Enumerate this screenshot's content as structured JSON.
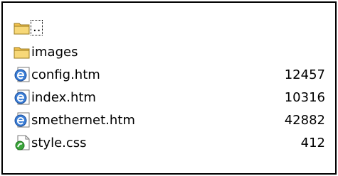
{
  "files": [
    {
      "name": "..",
      "icon": "folder-icon",
      "size": ""
    },
    {
      "name": "images",
      "icon": "folder-icon",
      "size": ""
    },
    {
      "name": "config.htm",
      "icon": "html-document-icon",
      "size": "12457"
    },
    {
      "name": "index.htm",
      "icon": "html-document-icon",
      "size": "10316"
    },
    {
      "name": "smethernet.htm",
      "icon": "html-document-icon",
      "size": "42882"
    },
    {
      "name": "style.css",
      "icon": "css-file-icon",
      "size": "412"
    }
  ]
}
